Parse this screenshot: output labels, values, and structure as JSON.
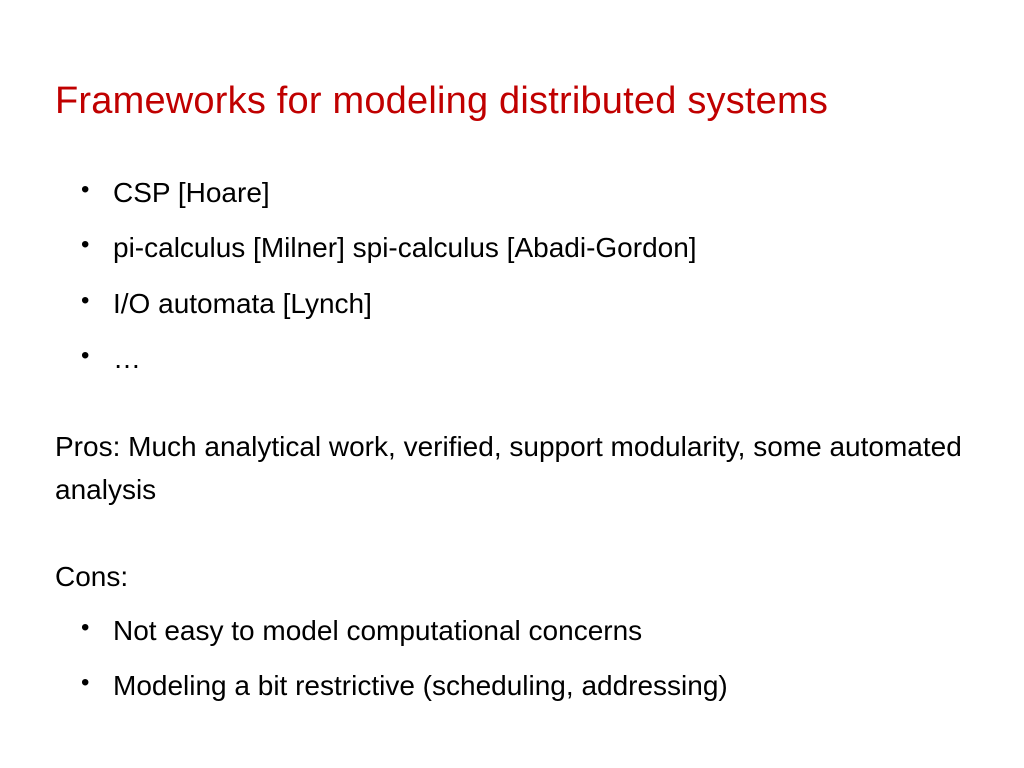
{
  "title": "Frameworks for modeling distributed systems",
  "frameworks": [
    "CSP [Hoare]",
    "pi-calculus [Milner]  spi-calculus [Abadi-Gordon]",
    "I/O automata [Lynch]",
    "…"
  ],
  "pros": "Pros:  Much analytical work,  verified, support modularity, some automated analysis",
  "cons_heading": "Cons:",
  "cons": [
    "Not easy to model computational concerns",
    "Modeling a bit restrictive (scheduling, addressing)"
  ]
}
